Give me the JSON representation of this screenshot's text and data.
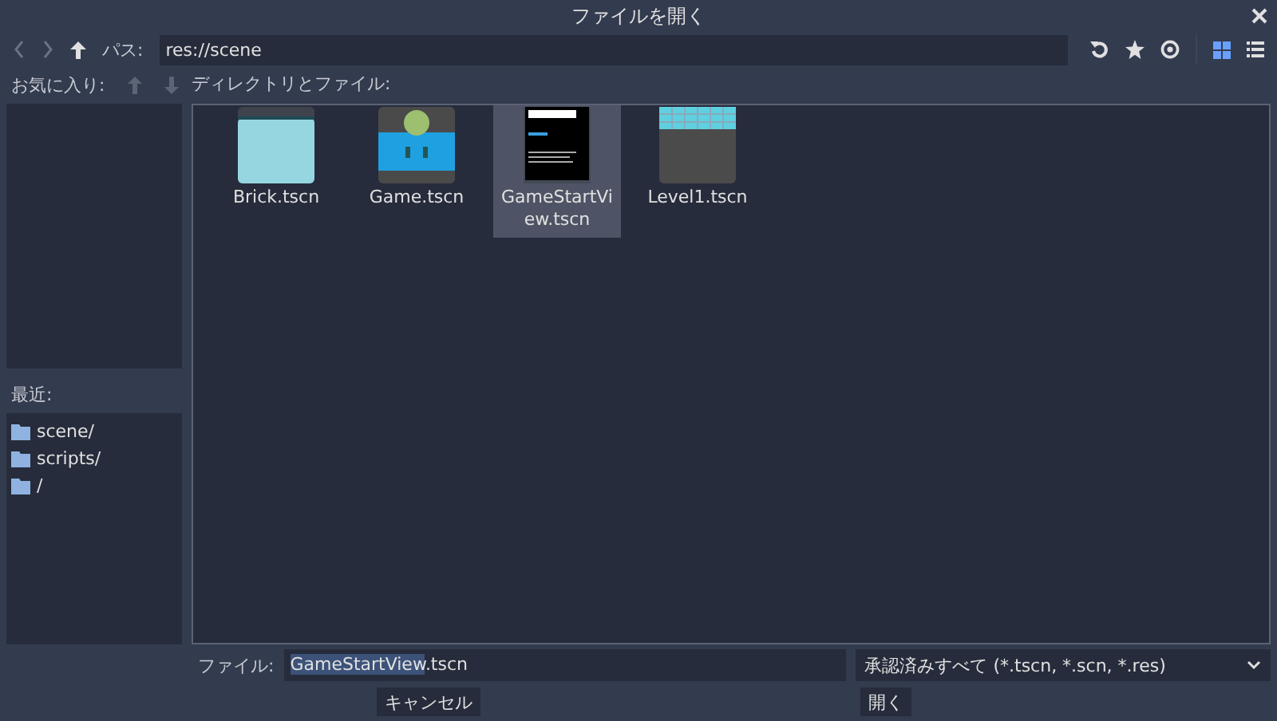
{
  "window": {
    "title": "ファイルを開く"
  },
  "toolbar": {
    "path_label": "パス:",
    "path": "res://scene",
    "view_buttons": [
      {
        "selected": true
      },
      {
        "selected": false
      }
    ]
  },
  "favorites": {
    "label": "お気に入り:"
  },
  "recent": {
    "label": "最近:",
    "items": [
      {
        "name": "scene/"
      },
      {
        "name": "scripts/"
      },
      {
        "name": "/"
      }
    ]
  },
  "files": {
    "label": "ディレクトリとファイル:",
    "items": [
      {
        "name": "Brick.tscn",
        "kind": "brick",
        "selected": false
      },
      {
        "name": "Game.tscn",
        "kind": "game",
        "selected": false
      },
      {
        "name": "GameStartView.tscn",
        "kind": "start",
        "selected": true
      },
      {
        "name": "Level1.tscn",
        "kind": "level",
        "selected": false
      }
    ]
  },
  "file_field": {
    "label": "ファイル:",
    "value_selected": "GameStartView",
    "value_rest": ".tscn"
  },
  "filter": {
    "value": "承認済みすべて (*.tscn, *.scn, *.res)"
  },
  "buttons": [
    {
      "label": "キャンセル"
    },
    {
      "label": "開く"
    }
  ]
}
